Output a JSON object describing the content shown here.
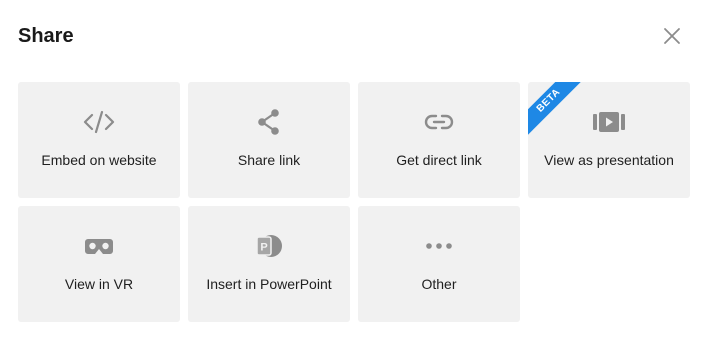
{
  "dialog": {
    "title": "Share",
    "close_icon": "close-icon"
  },
  "options": [
    {
      "label": "Embed on website",
      "icon": "code-icon"
    },
    {
      "label": "Share link",
      "icon": "share-icon"
    },
    {
      "label": "Get direct link",
      "icon": "link-icon"
    },
    {
      "label": "View as presentation",
      "icon": "presentation-play-icon",
      "badge": "BETA"
    },
    {
      "label": "View in VR",
      "icon": "vr-headset-icon"
    },
    {
      "label": "Insert in PowerPoint",
      "icon": "powerpoint-icon",
      "icon_letter": "P"
    },
    {
      "label": "Other",
      "icon": "more-dots-icon"
    }
  ],
  "colors": {
    "tile_bg": "#f1f1f1",
    "icon": "#8c8c8c",
    "badge": "#1e88e5",
    "text": "#1f1f1f"
  }
}
